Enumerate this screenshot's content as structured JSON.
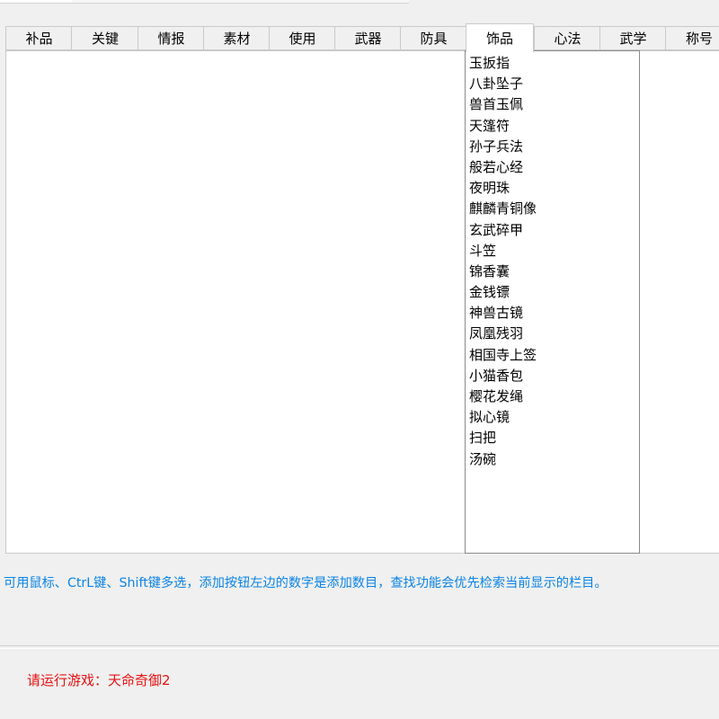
{
  "tabs": [
    {
      "label": "补品",
      "active": false
    },
    {
      "label": "关键",
      "active": false
    },
    {
      "label": "情报",
      "active": false
    },
    {
      "label": "素材",
      "active": false
    },
    {
      "label": "使用",
      "active": false
    },
    {
      "label": "武器",
      "active": false
    },
    {
      "label": "防具",
      "active": false
    },
    {
      "label": "饰品",
      "active": true
    },
    {
      "label": "心法",
      "active": false
    },
    {
      "label": "武学",
      "active": false
    },
    {
      "label": "称号",
      "active": false
    }
  ],
  "item_list": [
    "玉扳指",
    "八卦坠子",
    "兽首玉佩",
    "天篷符",
    "孙子兵法",
    "般若心经",
    "夜明珠",
    "麒麟青铜像",
    "玄武碎甲",
    "斗笠",
    "锦香囊",
    "金钱镖",
    "神兽古镜",
    "凤凰残羽",
    "相国寺上签",
    "小猫香包",
    "樱花发绳",
    "拟心镜",
    "扫把",
    "汤碗"
  ],
  "hint_text": "可用鼠标、CtrL键、Shift键多选，添加按钮左边的数字是添加数目，查找功能会优先检索当前显示的栏目。",
  "status_text": "请运行游戏：天命奇御2",
  "colors": {
    "hint": "#0a84e6",
    "status": "#e81010",
    "background": "#f0f0f0"
  }
}
